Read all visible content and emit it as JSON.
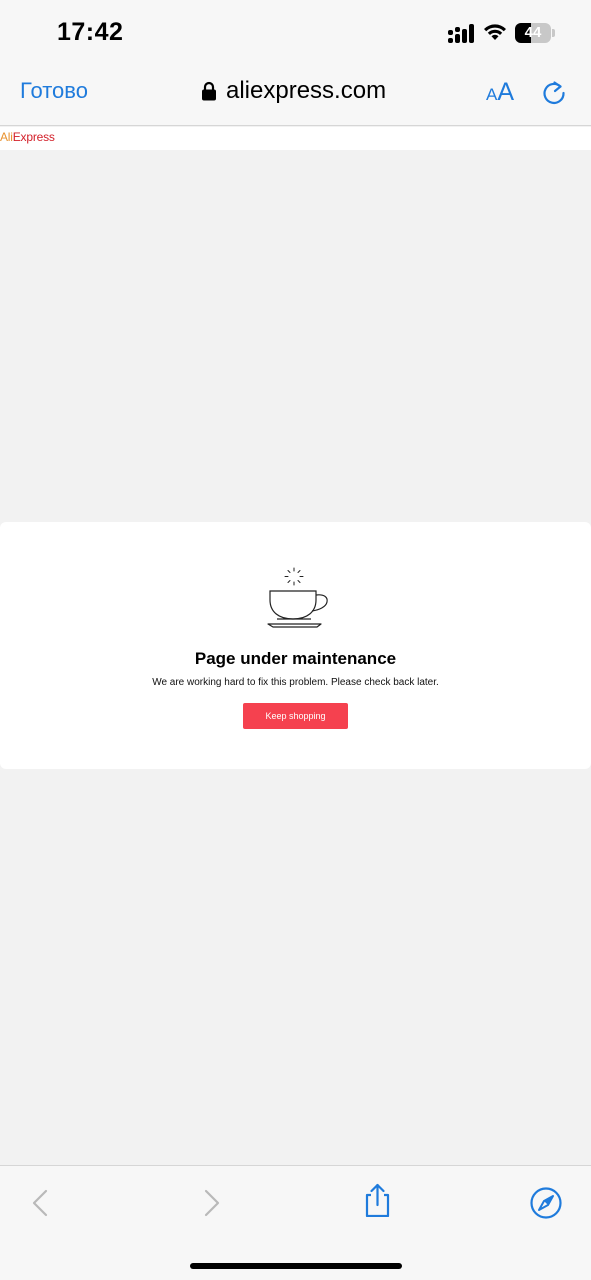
{
  "status_bar": {
    "time": "17:42",
    "battery_level": "44",
    "battery_fraction": 0.44
  },
  "browser": {
    "done_label": "Готово",
    "url": "aliexpress.com",
    "text_size_small": "A",
    "text_size_big": "A",
    "accent_color": "#1f7bdc"
  },
  "site": {
    "logo_part1": "Ali",
    "logo_part2": "Express"
  },
  "maintenance": {
    "title": "Page under maintenance",
    "message": "We are working hard to fix this problem. Please check back later.",
    "button_label": "Keep shopping",
    "button_color": "#f5414f"
  },
  "toolbar": {
    "icons": [
      "back-icon",
      "forward-icon",
      "share-icon",
      "compass-icon"
    ]
  }
}
